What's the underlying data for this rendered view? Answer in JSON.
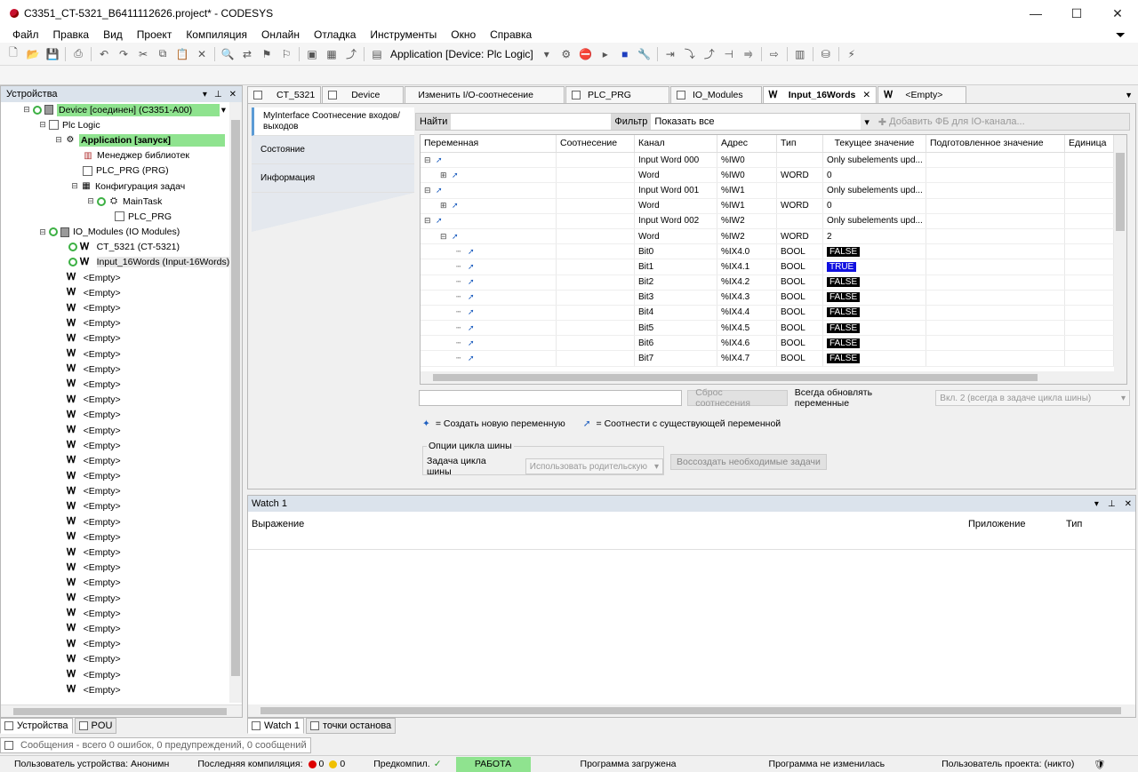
{
  "window": {
    "title": "C3351_CT-5321_B6411112626.project* - CODESYS",
    "buttons": [
      "—",
      "☐",
      "✕"
    ]
  },
  "menu": [
    "Файл",
    "Правка",
    "Вид",
    "Проект",
    "Компиляция",
    "Онлайн",
    "Отладка",
    "Инструменты",
    "Окно",
    "Справка"
  ],
  "toolbar": {
    "active_application": "Application [Device: Plc Logic]"
  },
  "devices_panel": {
    "title": "Устройства",
    "tree": [
      {
        "label": "Device [соединен] (C3351-A00)",
        "level": 0
      },
      {
        "label": "Plc Logic",
        "level": 1
      },
      {
        "label": "Application [запуск]",
        "level": 2
      },
      {
        "label": "Менеджер библиотек",
        "level": 3
      },
      {
        "label": "PLC_PRG (PRG)",
        "level": 3
      },
      {
        "label": "Конфигурация задач",
        "level": 3
      },
      {
        "label": "MainTask",
        "level": 4
      },
      {
        "label": "PLC_PRG",
        "level": 5
      },
      {
        "label": "IO_Modules (IO Modules)",
        "level": 1
      },
      {
        "label": "CT_5321 (CT-5321)",
        "level": 2
      },
      {
        "label": "Input_16Words (Input-16Words)",
        "level": 2
      }
    ],
    "empty_label": "<Empty>",
    "empty_count": 28
  },
  "left_bottom_tabs": [
    "Устройства",
    "POU"
  ],
  "editor_tabs": [
    {
      "label": "CT_5321",
      "active": false
    },
    {
      "label": "Device",
      "active": false
    },
    {
      "label": "Изменить I/O-соотнесение",
      "active": false
    },
    {
      "label": "PLC_PRG",
      "active": false
    },
    {
      "label": "IO_Modules",
      "active": false
    },
    {
      "label": "Input_16Words",
      "active": true
    },
    {
      "label": "<Empty>",
      "active": false
    }
  ],
  "side_nav": [
    "MyInterface Соотнесение входов/выходов",
    "Состояние",
    "Информация"
  ],
  "find_bar": {
    "find_label": "Найти",
    "filter_label": "Фильтр",
    "filter_value": "Показать все",
    "add_fb": "Добавить ФБ для IO-канала..."
  },
  "grid": {
    "columns": [
      "Переменная",
      "Соотнесение",
      "Канал",
      "Адрес",
      "Тип",
      "Текущее значение",
      "Подготовленное значение",
      "Единица"
    ],
    "rows": [
      {
        "depth": 0,
        "exp": "⊟",
        "channel": "Input Word 000",
        "address": "%IW0",
        "type": "",
        "current": "Only subelements upd..."
      },
      {
        "depth": 1,
        "exp": "⊞",
        "channel": "Word",
        "address": "%IW0",
        "type": "WORD",
        "current": "0"
      },
      {
        "depth": 0,
        "exp": "⊟",
        "channel": "Input Word 001",
        "address": "%IW1",
        "type": "",
        "current": "Only subelements upd..."
      },
      {
        "depth": 1,
        "exp": "⊞",
        "channel": "Word",
        "address": "%IW1",
        "type": "WORD",
        "current": "0"
      },
      {
        "depth": 0,
        "exp": "⊟",
        "channel": "Input Word 002",
        "address": "%IW2",
        "type": "",
        "current": "Only subelements upd..."
      },
      {
        "depth": 1,
        "exp": "⊟",
        "channel": "Word",
        "address": "%IW2",
        "type": "WORD",
        "current": "2"
      },
      {
        "depth": 2,
        "exp": "",
        "channel": "Bit0",
        "address": "%IX4.0",
        "type": "BOOL",
        "current": "FALSE"
      },
      {
        "depth": 2,
        "exp": "",
        "channel": "Bit1",
        "address": "%IX4.1",
        "type": "BOOL",
        "current": "TRUE"
      },
      {
        "depth": 2,
        "exp": "",
        "channel": "Bit2",
        "address": "%IX4.2",
        "type": "BOOL",
        "current": "FALSE"
      },
      {
        "depth": 2,
        "exp": "",
        "channel": "Bit3",
        "address": "%IX4.3",
        "type": "BOOL",
        "current": "FALSE"
      },
      {
        "depth": 2,
        "exp": "",
        "channel": "Bit4",
        "address": "%IX4.4",
        "type": "BOOL",
        "current": "FALSE"
      },
      {
        "depth": 2,
        "exp": "",
        "channel": "Bit5",
        "address": "%IX4.5",
        "type": "BOOL",
        "current": "FALSE"
      },
      {
        "depth": 2,
        "exp": "",
        "channel": "Bit6",
        "address": "%IX4.6",
        "type": "BOOL",
        "current": "FALSE"
      },
      {
        "depth": 2,
        "exp": "",
        "channel": "Bit7",
        "address": "%IX4.7",
        "type": "BOOL",
        "current": "FALSE"
      }
    ]
  },
  "mapping_controls": {
    "reset_button": "Сброс соотнесения",
    "always_update_label": "Всегда обновлять переменные",
    "always_update_value": "Вкл. 2 (всегда в задаче цикла шины)",
    "legend_new": "= Создать новую переменную",
    "legend_existing": "= Соотнести с существующей переменной",
    "bus_cycle_group": "Опции цикла шины",
    "bus_cycle_task_label": "Задача цикла шины",
    "bus_cycle_task_value": "Использовать родительскую",
    "recreate_button": "Воссоздать необходимые задачи"
  },
  "watch": {
    "title": "Watch 1",
    "columns": [
      "Выражение",
      "Приложение",
      "Тип"
    ]
  },
  "right_bottom_tabs": [
    "Watch 1",
    "точки останова"
  ],
  "messages": "Сообщения - всего 0 ошибок, 0 предупреждений, 0 сообщений",
  "status": {
    "device_user": "Пользователь устройства: Анонимн",
    "last_build": "Последняя компиляция:",
    "errors": "0",
    "warnings": "0",
    "precompile": "Предкомпил.",
    "run_state": "РАБОТА",
    "program_loaded": "Программа загружена",
    "program_unchanged": "Программа не изменилась",
    "project_user": "Пользователь проекта: (никто)"
  },
  "colors": {
    "run_green": "#8fe38f",
    "false_bg": "#000000",
    "true_bg": "#1010e0",
    "panel_header": "#dbe3ec"
  }
}
